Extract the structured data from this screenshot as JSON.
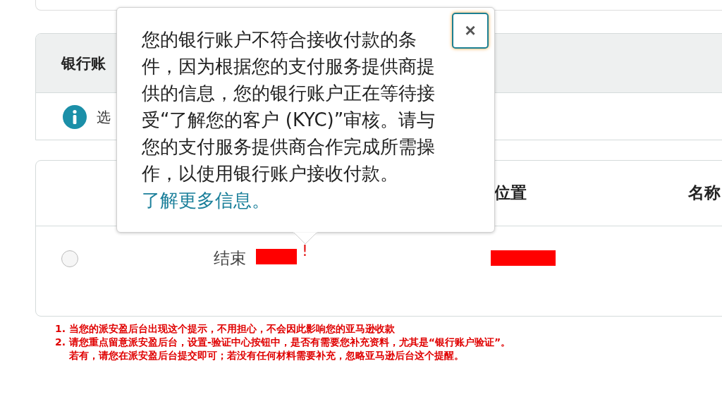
{
  "panel": {
    "title": "银行账",
    "notice": {
      "kind": "info",
      "text": "选"
    },
    "table": {
      "columns": [
        {
          "label": "位置"
        },
        {
          "label": "名称"
        }
      ],
      "rows": [
        {
          "selected": false,
          "end_label": "结束",
          "warning": "!",
          "redacted": true,
          "location_redacted": true
        }
      ]
    }
  },
  "popover": {
    "text": "您的银行账户不符合接收付款的条件，因为根据您的支付服务提供商提供的信息，您的银行账户正在等待接受“了解您的客户 (KYC)”审核。请与您的支付服务提供商合作完成所需操作，以使用银行账户接收付款。",
    "link": "了解更多信息。",
    "close": "×"
  },
  "annotations": [
    "1. 当您的派安盈后台出现这个提示，不用担心，不会因此影响您的亚马逊收款",
    "2. 请您重点留意派安盈后台，设置-验证中心按钮中，是否有需要您补充资料，尤其是“银行账户验证”。",
    "若有，请您在派安盈后台提交即可；若没有任何材料需要补充，忽略亚马逊后台这个提醒。"
  ]
}
